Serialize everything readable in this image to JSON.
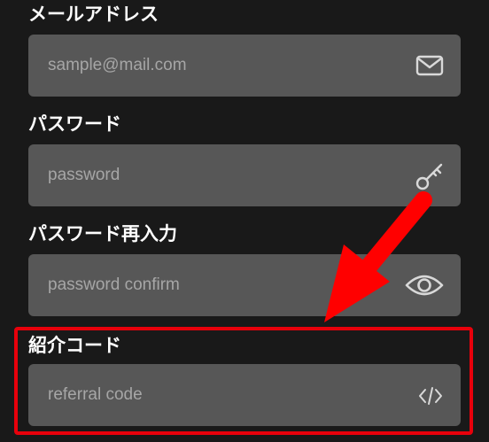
{
  "form": {
    "email": {
      "label": "メールアドレス",
      "placeholder": "sample@mail.com",
      "icon": "envelope-icon"
    },
    "password": {
      "label": "パスワード",
      "placeholder": "password",
      "icon": "key-icon"
    },
    "password_confirm": {
      "label": "パスワード再入力",
      "placeholder": "password confirm",
      "icon": "eye-icon"
    },
    "referral": {
      "label": "紹介コード",
      "placeholder": "referral code",
      "icon": "code-icon"
    }
  },
  "annotation": {
    "highlight_color": "#e8000b",
    "arrow_color": "#ff0000",
    "icon": "arrow-pointer"
  },
  "colors": {
    "background": "#191919",
    "field_background": "#575757",
    "label_text": "#ffffff",
    "placeholder_text": "#a6a6a6",
    "icon_stroke": "#d9d9d9"
  }
}
